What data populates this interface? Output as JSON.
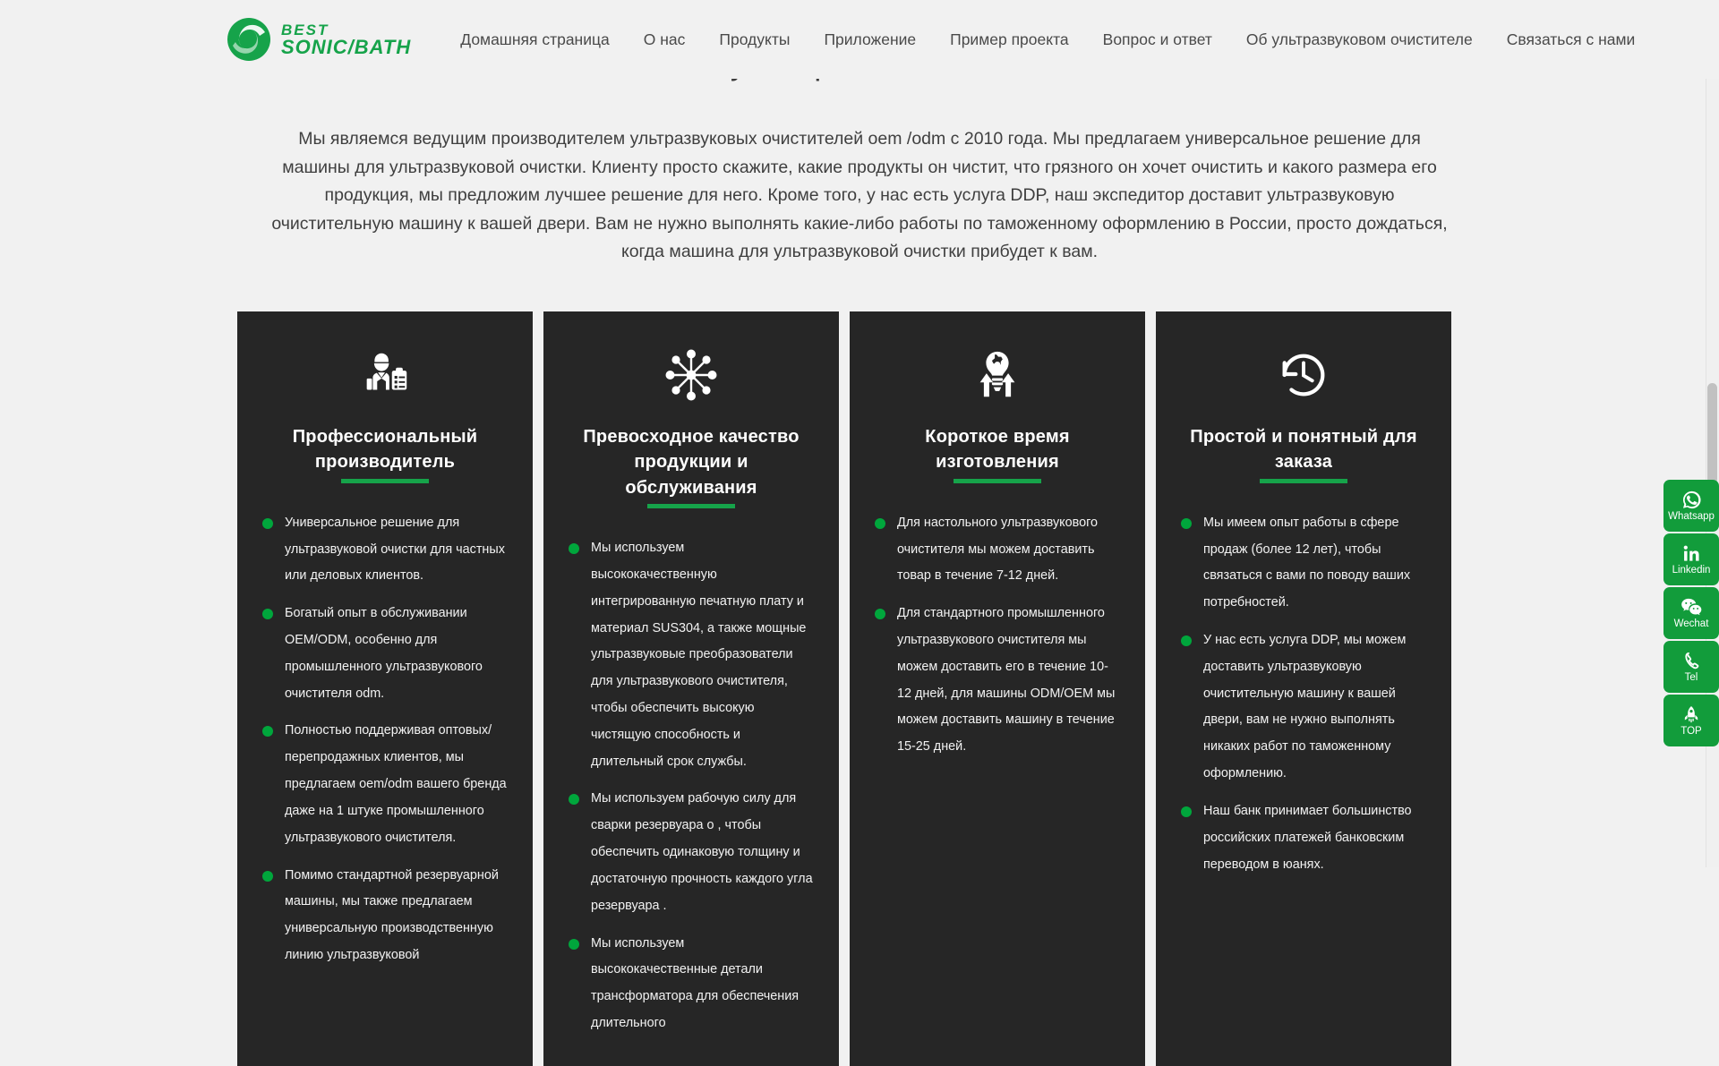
{
  "brand": {
    "line1": "BEST",
    "line2": "SONIC/BATH",
    "color": "#16a34a",
    "logo_icon": "swirl-logo-icon"
  },
  "nav": {
    "items": [
      {
        "label": "Домашняя страница"
      },
      {
        "label": "О нас"
      },
      {
        "label": "Продукты"
      },
      {
        "label": "Приложение"
      },
      {
        "label": "Пример проекта"
      },
      {
        "label": "Вопрос и ответ"
      },
      {
        "label": "Об ультразвуковом очистителе"
      },
      {
        "label": "Связаться с нами"
      }
    ]
  },
  "main": {
    "title": "Почему выбрали именно нас?",
    "intro": "Мы являемся ведущим производителем ультразвуковых очистителей oem /odm с 2010 года. Мы предлагаем универсальное решение для машины для ультразвуковой очистки. Клиенту просто скажите, какие продукты он чистит, что грязного он хочет очистить и какого размера его продукция, мы предложим лучшее решение для него. Кроме того, у нас есть услуга DDP, наш экспедитор доставит ультразвуковую очистительную машину к вашей двери. Вам не нужно выполнять какие-либо работы по таможенному оформлению в России, просто дождаться, когда машина для ультразвуковой очистки прибудет к вам."
  },
  "cards": [
    {
      "icon": "engineer-clipboard-icon",
      "title": "Профессиональный производитель",
      "items": [
        "Универсальное решение для ультразвуковой очистки для частных или деловых клиентов.",
        "Богатый опыт в обслуживании OEM/ODM, особенно для промышленного ультразвукового очистителя odm.",
        "Полностью поддерживая оптовых/ перепродажных клиентов, мы предлагаем oem/odm вашего бренда даже на 1 штуке промышленного ультразвукового очистителя.",
        "Помимо стандартной резервуарной машины, мы также предлагаем универсальную производственную линию ультразвуковой"
      ]
    },
    {
      "icon": "molecule-network-icon",
      "title": "Превосходное качество продукции и обслуживания",
      "items": [
        "Мы используем высококачественную интегрированную печатную плату и материал SUS304, а также мощные ультразвуковые преобразователи для ультразвукового очистителя, чтобы обеспечить высокую чистящую способность и длительный срок службы.",
        "Мы используем рабочую силу для сварки резервуара о , чтобы обеспечить одинаковую толщину и достаточную прочность каждого угла резервуара .",
        "Мы используем высококачественные детали трансформатора для обеспечения длительного"
      ]
    },
    {
      "icon": "gear-bulb-arrows-icon",
      "title": "Короткое время изготовления",
      "items": [
        "Для настольного ультразвукового очистителя мы можем доставить товар в течение 7-12 дней.",
        "Для стандартного промышленного ультразвукового очистителя мы можем доставить его в течение 10-12 дней, для машины ODM/OEM мы можем доставить машину в течение 15-25 дней."
      ]
    },
    {
      "icon": "clock-rewind-icon",
      "title": "Простой и понятный для заказа",
      "items": [
        "Мы имеем опыт работы в сфере продаж (более 12 лет), чтобы связаться с вами по поводу ваших потребностей.",
        "У нас есть услуга DDP, мы можем доставить ультразвуковую очистительную машину к вашей двери, вам не нужно выполнять никаких работ по таможенному оформлению.",
        "Наш банк принимает большинство российских платежей банковским переводом в юанях."
      ]
    }
  ],
  "social": {
    "accent": "#129c3b",
    "buttons": [
      {
        "icon": "whatsapp-icon",
        "label": "Whatsapp"
      },
      {
        "icon": "linkedin-icon",
        "label": "Linkedin"
      },
      {
        "icon": "wechat-icon",
        "label": "Wechat"
      },
      {
        "icon": "phone-icon",
        "label": "Tel"
      },
      {
        "icon": "rocket-icon",
        "label": "TOP"
      }
    ]
  }
}
